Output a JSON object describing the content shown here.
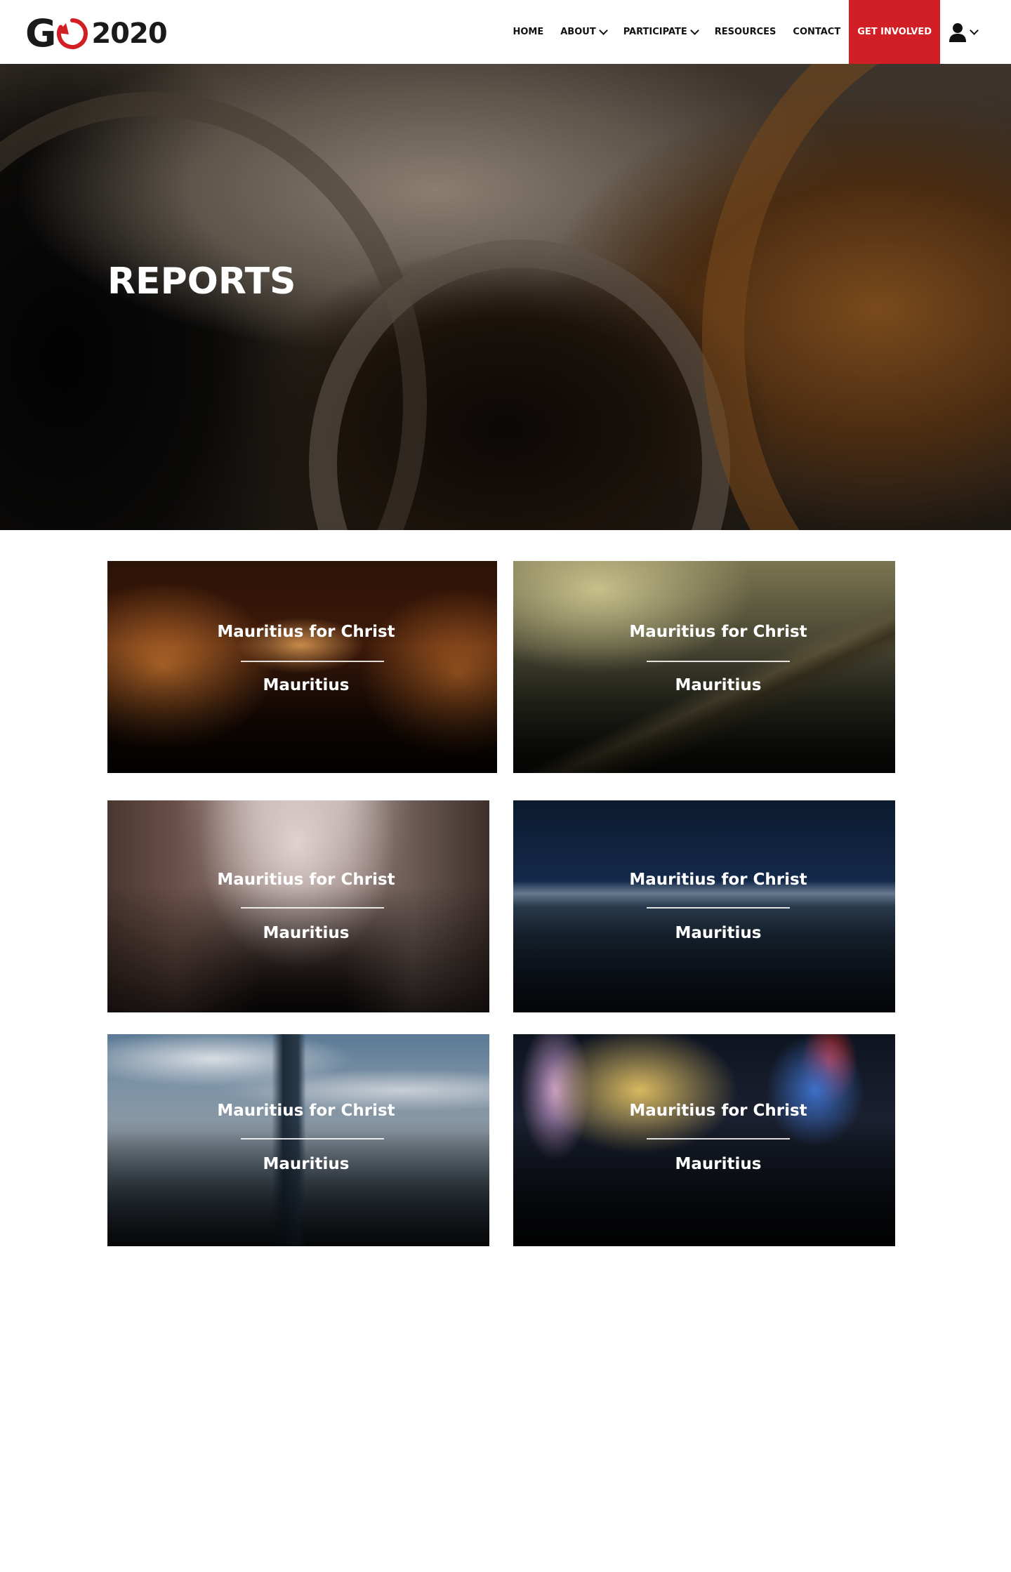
{
  "header": {
    "logo_letter": "G",
    "logo_year": "2020",
    "nav": [
      {
        "label": "HOME",
        "has_dropdown": false
      },
      {
        "label": "ABOUT",
        "has_dropdown": true
      },
      {
        "label": "PARTICIPATE",
        "has_dropdown": true
      },
      {
        "label": "RESOURCES",
        "has_dropdown": false
      },
      {
        "label": "CONTACT",
        "has_dropdown": false
      }
    ],
    "cta_label": "GET INVOLVED",
    "user_icon": "user-icon"
  },
  "hero": {
    "title": "REPORTS"
  },
  "cards": [
    {
      "title": "Mauritius for Christ",
      "subtitle": "Mauritius"
    },
    {
      "title": "Mauritius for Christ",
      "subtitle": "Mauritius"
    },
    {
      "title": "Mauritius for Christ",
      "subtitle": "Mauritius"
    },
    {
      "title": "Mauritius for Christ",
      "subtitle": "Mauritius"
    },
    {
      "title": "Mauritius for Christ",
      "subtitle": "Mauritius"
    },
    {
      "title": "Mauritius for Christ",
      "subtitle": "Mauritius"
    }
  ],
  "colors": {
    "brand_red": "#d11f25",
    "logo_dark": "#1a1a1a",
    "text_white": "#ffffff"
  }
}
